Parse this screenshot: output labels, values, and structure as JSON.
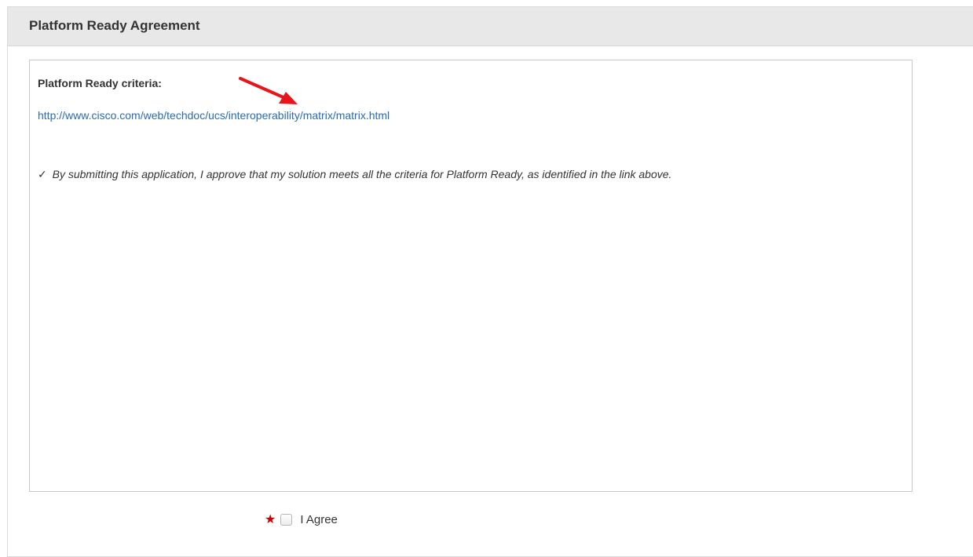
{
  "panel": {
    "title": "Platform Ready Agreement"
  },
  "agreement": {
    "criteria_heading": "Platform Ready criteria:",
    "criteria_link": "http://www.cisco.com/web/techdoc/ucs/interoperability/matrix/matrix.html",
    "check_glyph": "✓",
    "approval_text": "By submitting this application, I approve that my solution meets all the criteria for Platform Ready, as identified in the link above."
  },
  "agree": {
    "required_glyph": "★",
    "label": "I Agree",
    "checked": false
  },
  "colors": {
    "header_background": "#e8e8e8",
    "link": "#2a6ab1",
    "required": "#cc0000",
    "annotation_arrow": "#e8141b"
  },
  "icons": {
    "annotation": "red-arrow-icon",
    "check": "check-mark-icon",
    "required": "required-star-icon"
  }
}
